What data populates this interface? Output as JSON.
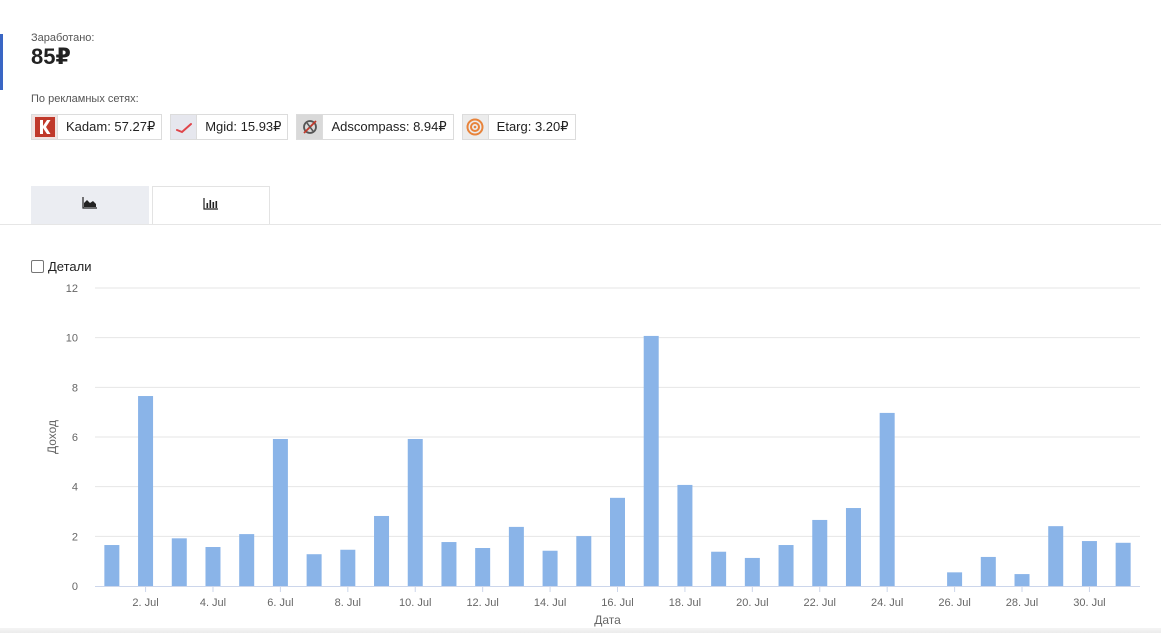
{
  "summary": {
    "earned_label": "Заработано:",
    "earned_value": "85₽",
    "networks_label": "По рекламных сетях:"
  },
  "networks": [
    {
      "name": "Kadam",
      "text": "Kadam: 57.27₽",
      "icon": "kadam-logo-icon",
      "color": "#c0392b"
    },
    {
      "name": "Mgid",
      "text": "Mgid: 15.93₽",
      "icon": "mgid-logo-icon",
      "color": "#e0454a"
    },
    {
      "name": "Adscompass",
      "text": "Adscompass: 8.94₽",
      "icon": "adscompass-logo-icon",
      "color": "#555555"
    },
    {
      "name": "Etarg",
      "text": "Etarg: 3.20₽",
      "icon": "etarg-logo-icon",
      "color": "#e8833a"
    }
  ],
  "tabs": [
    {
      "name": "area-chart-tab",
      "icon": "area-chart-icon",
      "active": false
    },
    {
      "name": "bar-chart-tab",
      "icon": "bar-chart-icon",
      "active": true
    }
  ],
  "details_toggle": {
    "label": "Детали",
    "checked": false
  },
  "chart_data": {
    "type": "bar",
    "x": [
      1,
      2,
      3,
      4,
      5,
      6,
      7,
      8,
      9,
      10,
      11,
      12,
      13,
      14,
      15,
      16,
      17,
      18,
      19,
      20,
      21,
      22,
      23,
      24,
      25,
      26,
      27,
      28,
      29,
      30,
      31
    ],
    "values": [
      1.65,
      7.65,
      1.92,
      1.57,
      2.09,
      5.92,
      1.28,
      1.46,
      2.82,
      5.92,
      1.77,
      1.53,
      2.38,
      1.42,
      2.01,
      3.55,
      10.07,
      4.07,
      1.38,
      1.13,
      1.65,
      2.66,
      3.14,
      6.97,
      0,
      0.55,
      1.17,
      0.48,
      2.41,
      1.81,
      1.74
    ],
    "x_tick_labels": [
      "2. Jul",
      "4. Jul",
      "6. Jul",
      "8. Jul",
      "10. Jul",
      "12. Jul",
      "14. Jul",
      "16. Jul",
      "18. Jul",
      "20. Jul",
      "22. Jul",
      "24. Jul",
      "26. Jul",
      "28. Jul",
      "30. Jul"
    ],
    "x_tick_values": [
      2,
      4,
      6,
      8,
      10,
      12,
      14,
      16,
      18,
      20,
      22,
      24,
      26,
      28,
      30
    ],
    "y_ticks": [
      0,
      2,
      4,
      6,
      8,
      10,
      12
    ],
    "ylim": [
      0,
      12
    ],
    "xlabel": "Дата",
    "ylabel": "Доход",
    "grid": true,
    "bar_color": "#8ab4e8"
  }
}
